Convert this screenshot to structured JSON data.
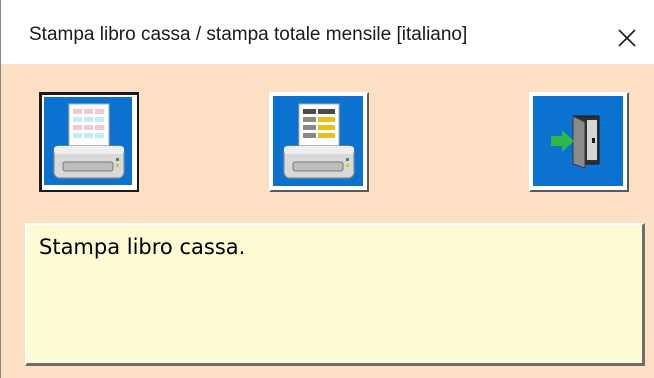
{
  "window": {
    "title": "Stampa libro cassa / stampa totale mensile   [italiano]",
    "close_label": "✕"
  },
  "toolbar": {
    "buttons": [
      {
        "name": "print-cashbook-button",
        "icon": "printer-colored-sheet-icon",
        "state": "pressed"
      },
      {
        "name": "print-monthly-total-button",
        "icon": "printer-table-sheet-icon",
        "state": "raised"
      },
      {
        "name": "exit-button",
        "icon": "exit-door-icon",
        "state": "raised"
      }
    ]
  },
  "message": {
    "text": "Stampa libro cassa."
  },
  "colors": {
    "background": "#fde0c3",
    "button_face": "#0b72d0",
    "message_background": "#fdfbd3"
  }
}
